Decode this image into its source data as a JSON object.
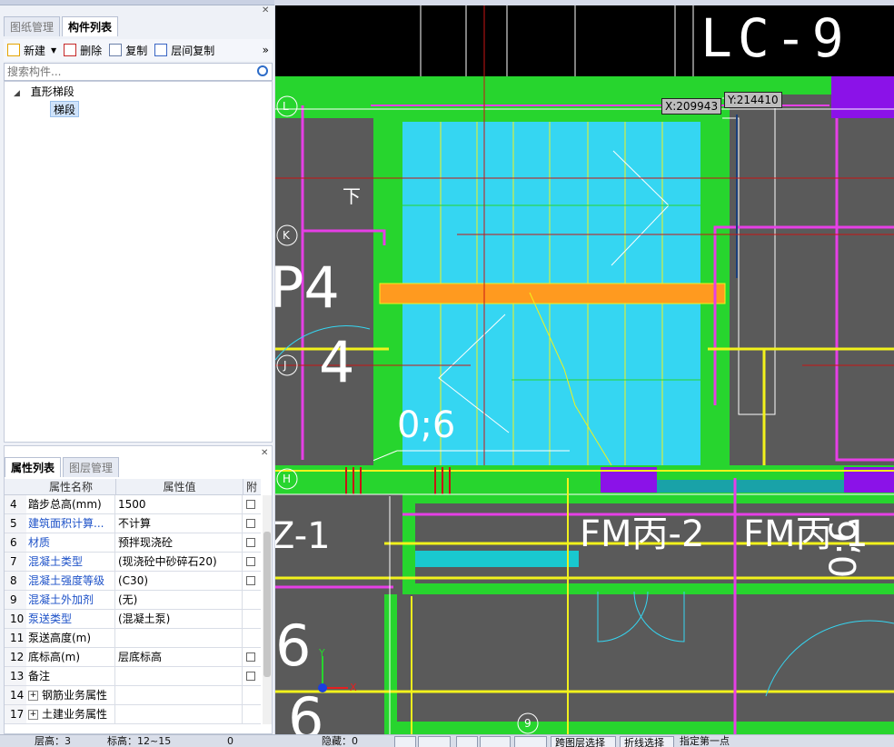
{
  "left_top_tabs": [
    "图纸管理",
    "构件列表"
  ],
  "toolbar": {
    "new_label": "新建",
    "delete_label": "删除",
    "copy_label": "复制",
    "floor_copy_label": "层间复制",
    "more_label": "»"
  },
  "search": {
    "placeholder": "搜索构件..."
  },
  "tree": {
    "root": "直形梯段",
    "child": "梯段"
  },
  "prop_tabs": [
    "属性列表",
    "图层管理"
  ],
  "prop_table": {
    "headers": {
      "name": "属性名称",
      "value": "属性值",
      "attach": "附"
    },
    "rows": [
      {
        "num": "4",
        "name": "踏步总高(mm)",
        "value": "1500",
        "blue": false,
        "check": true
      },
      {
        "num": "5",
        "name": "建筑面积计算...",
        "value": "不计算",
        "blue": true,
        "check": true
      },
      {
        "num": "6",
        "name": "材质",
        "value": "预拌现浇砼",
        "blue": true,
        "check": true
      },
      {
        "num": "7",
        "name": "混凝土类型",
        "value": "(现浇砼中砂碎石20)",
        "blue": true,
        "check": true
      },
      {
        "num": "8",
        "name": "混凝土强度等级",
        "value": "(C30)",
        "blue": true,
        "check": true
      },
      {
        "num": "9",
        "name": "混凝土外加剂",
        "value": "(无)",
        "blue": true,
        "check": false
      },
      {
        "num": "10",
        "name": "泵送类型",
        "value": "(混凝土泵)",
        "blue": true,
        "check": false
      },
      {
        "num": "11",
        "name": "泵送高度(m)",
        "value": "",
        "blue": false,
        "check": false
      },
      {
        "num": "12",
        "name": "底标高(m)",
        "value": "层底标高",
        "blue": false,
        "check": true
      },
      {
        "num": "13",
        "name": "备注",
        "value": "",
        "blue": false,
        "check": true
      },
      {
        "num": "14",
        "name": "钢筋业务属性",
        "value": "",
        "blue": false,
        "check": false,
        "expand": true
      },
      {
        "num": "17",
        "name": "土建业务属性",
        "value": "",
        "blue": false,
        "check": false,
        "expand": true
      }
    ]
  },
  "canvas": {
    "coord_x": "X:209943",
    "coord_y": "Y:214410",
    "axis_labels": [
      "L",
      "K",
      "J",
      "H",
      "9"
    ],
    "texts": {
      "lc9": "LC-9",
      "stair_label": "0;6",
      "fm1": "FM丙-2",
      "fm2": "FM丙-1",
      "sym06": "0;6",
      "z1": "Z-1",
      "p4": "P4",
      "n4": "4",
      "n6a": "6",
      "n6b": "6",
      "down": "下",
      "axis_x": "X",
      "axis_y": "Y"
    }
  },
  "statusbar": {
    "floor": "层高：3",
    "elev": "标高：12~15",
    "zero": "0",
    "hidden": "隐藏：0",
    "btn1": "跨图层选择",
    "btn2": "折线选择",
    "btn3": "指定第一点"
  },
  "colors": {
    "green": "#27d52e",
    "cyan": "#35d6f2",
    "magenta": "#e63fe6",
    "yellow": "#f2f21c",
    "orange": "#ff9a1f",
    "purple": "#8b12e8",
    "dark_gray": "#5a5a5a",
    "black": "#000000"
  }
}
